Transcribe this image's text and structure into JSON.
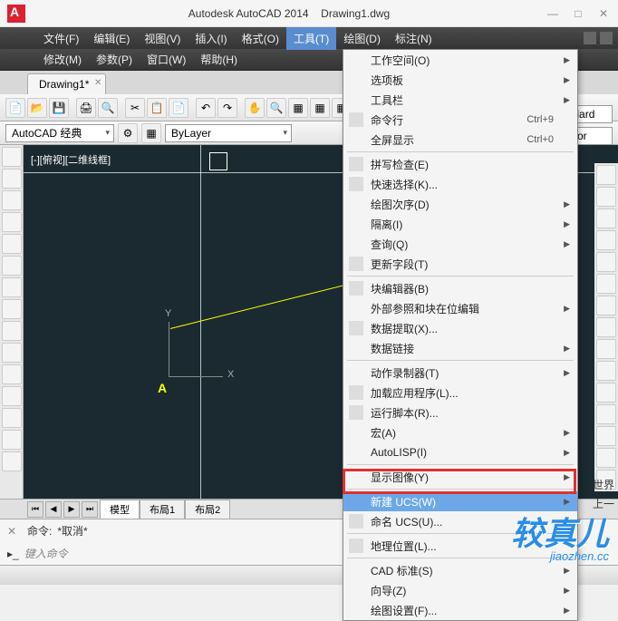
{
  "title": {
    "app": "Autodesk AutoCAD 2014",
    "file": "Drawing1.dwg"
  },
  "menubar": {
    "row1": [
      "文件(F)",
      "编辑(E)",
      "视图(V)",
      "插入(I)",
      "格式(O)",
      "工具(T)",
      "绘图(D)",
      "标注(N)"
    ],
    "row2": [
      "修改(M)",
      "参数(P)",
      "窗口(W)",
      "帮助(H)"
    ],
    "active": "工具(T)"
  },
  "file_tab": {
    "label": "Drawing1*"
  },
  "combos": {
    "workspace": "AutoCAD 经典",
    "layer": "ByLayer",
    "style1": "andard",
    "style2": "Color"
  },
  "viewport_label": "[-][俯视][二维线框]",
  "ucs": {
    "x": "X",
    "y": "Y",
    "point": "A"
  },
  "layout_tabs": {
    "items": [
      "模型",
      "布局1",
      "布局2"
    ],
    "active": "模型"
  },
  "command": {
    "label": "命令:",
    "last": "*取消*",
    "placeholder": "键入命令"
  },
  "dropdown": {
    "groups": [
      [
        {
          "label": "工作空间(O)",
          "sub": true
        },
        {
          "label": "选项板",
          "sub": true
        },
        {
          "label": "工具栏",
          "sub": true
        },
        {
          "label": "命令行",
          "shortcut": "Ctrl+9",
          "icon": true
        },
        {
          "label": "全屏显示",
          "shortcut": "Ctrl+0"
        }
      ],
      [
        {
          "label": "拼写检查(E)",
          "icon": true
        },
        {
          "label": "快速选择(K)...",
          "icon": true
        },
        {
          "label": "绘图次序(D)",
          "sub": true
        },
        {
          "label": "隔离(I)",
          "sub": true
        },
        {
          "label": "查询(Q)",
          "sub": true
        },
        {
          "label": "更新字段(T)",
          "icon": true
        }
      ],
      [
        {
          "label": "块编辑器(B)",
          "icon": true
        },
        {
          "label": "外部参照和块在位编辑",
          "sub": true
        },
        {
          "label": "数据提取(X)...",
          "icon": true
        },
        {
          "label": "数据链接",
          "sub": true
        }
      ],
      [
        {
          "label": "动作录制器(T)",
          "sub": true
        },
        {
          "label": "加载应用程序(L)...",
          "icon": true
        },
        {
          "label": "运行脚本(R)...",
          "icon": true
        },
        {
          "label": "宏(A)",
          "sub": true
        },
        {
          "label": "AutoLISP(I)",
          "sub": true
        }
      ],
      [
        {
          "label": "显示图像(Y)",
          "sub": true
        }
      ],
      [
        {
          "label": "新建 UCS(W)",
          "sub": true,
          "highlight": true
        },
        {
          "label": "命名 UCS(U)...",
          "icon": true
        }
      ],
      [
        {
          "label": "地理位置(L)...",
          "icon": true
        }
      ],
      [
        {
          "label": "CAD 标准(S)",
          "sub": true
        },
        {
          "label": "向导(Z)",
          "sub": true
        },
        {
          "label": "绘图设置(F)...",
          "sub": true
        }
      ]
    ]
  },
  "side_text": {
    "world": "世界",
    "up": "上一"
  },
  "watermark": {
    "main": "较真儿",
    "sub": "jiaozhen.cc"
  }
}
